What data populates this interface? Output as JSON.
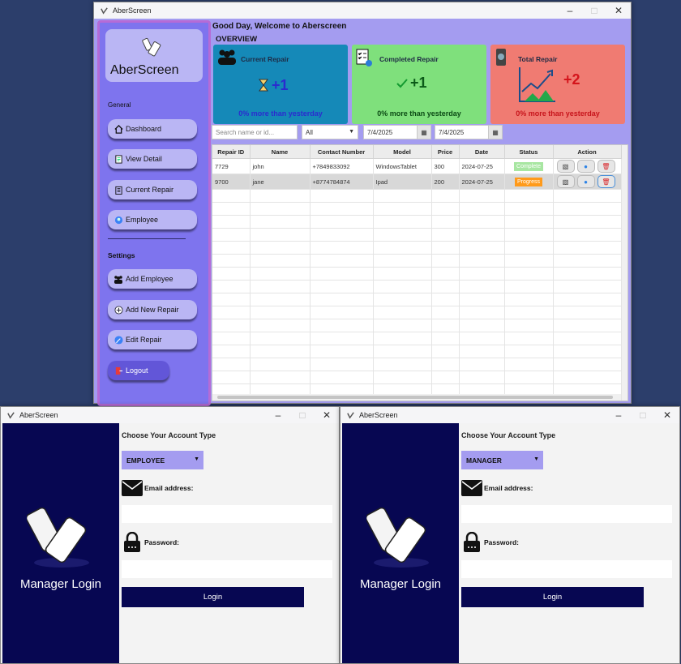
{
  "main_window": {
    "title": "AberScreen",
    "greeting": "Good Day, Welcome to Aberscreen",
    "overview_label": "OVERVIEW",
    "sidebar": {
      "brand": "AberScreen",
      "general_heading": "General",
      "settings_heading": "Settings",
      "items": [
        {
          "label": "Dashboard",
          "icon": "home-icon"
        },
        {
          "label": "View Detail",
          "icon": "document-icon"
        },
        {
          "label": "Current Repair",
          "icon": "clipboard-icon"
        },
        {
          "label": "Employee",
          "icon": "employee-icon"
        },
        {
          "label": "Add Employee",
          "icon": "group-icon"
        },
        {
          "label": "Add New Repair",
          "icon": "add-repair-icon"
        },
        {
          "label": "Edit Repair",
          "icon": "edit-icon"
        },
        {
          "label": "Logout",
          "icon": "logout-icon"
        }
      ]
    },
    "cards": [
      {
        "title": "Current Repair",
        "value": "+1",
        "subtitle": "0% more than yesterday",
        "color": "#1589b8",
        "icon": "people-icon"
      },
      {
        "title": "Completed Repair",
        "value": "+1",
        "subtitle": "0% more than yesterday",
        "color": "#7fe07c",
        "icon": "checklist-icon"
      },
      {
        "title": "Total Repair",
        "value": "+2",
        "subtitle": "0%  more than yesterday",
        "color": "#f07b72",
        "icon": "chart-up-icon"
      }
    ],
    "filters": {
      "search_placeholder": "Search name or id...",
      "status_select": "All",
      "date_from": "7/4/2025",
      "date_to": "7/4/2025"
    },
    "table": {
      "headers": [
        "Repair ID",
        "Name",
        "Contact Number",
        "Model",
        "Price",
        "Date",
        "Status",
        "Action"
      ],
      "rows": [
        {
          "id": "7729",
          "name": "john",
          "contact": "+7849833092",
          "model": "WindowsTablet",
          "price": "300",
          "date": "2024-07-25",
          "status": "Complete",
          "status_color": "#a8e6a2"
        },
        {
          "id": "9700",
          "name": "jane",
          "contact": "+8774784874",
          "model": "Ipad",
          "price": "200",
          "date": "2024-07-25",
          "status": "Progress",
          "status_color": "#ff9a1a"
        }
      ]
    }
  },
  "login_windows": [
    {
      "title": "AberScreen",
      "panel_title": "Manager Login",
      "heading": "Choose Your Account Type",
      "account_type": "EMPLOYEE",
      "email_label": "Email address:",
      "password_label": "Password:",
      "button": "Login"
    },
    {
      "title": "AberScreen",
      "panel_title": "Manager Login",
      "heading": "Choose Your Account Type",
      "account_type": "MANAGER",
      "email_label": "Email address:",
      "password_label": "Password:",
      "button": "Login"
    }
  ]
}
